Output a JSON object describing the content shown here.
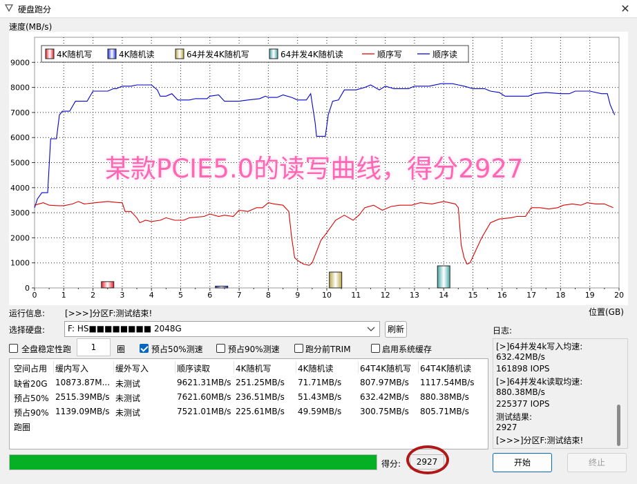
{
  "window": {
    "title": "硬盘跑分",
    "close_glyph": "✕"
  },
  "chart_labels": {
    "y_unit": "速度(MB/s)",
    "x_unit": "位置(GB)"
  },
  "watermark": "某款PCIE5.0的读写曲线，得分2927",
  "chart_data": {
    "type": "line",
    "ylim": [
      0,
      10000
    ],
    "xlim": [
      0,
      20
    ],
    "yticks": [
      0,
      1000,
      2000,
      3000,
      4000,
      5000,
      6000,
      7000,
      8000,
      9000
    ],
    "xticks": [
      0,
      1,
      2,
      3,
      4,
      5,
      6,
      7,
      8,
      9,
      10,
      11,
      12,
      13,
      14,
      15,
      16,
      17,
      18,
      19,
      20
    ],
    "grid": true,
    "legend_placement": "top-left",
    "legend": [
      "4K随机写",
      "4K随机读",
      "64并发4K随机写",
      "64并发4K随机读",
      "顺序写",
      "顺序读"
    ],
    "colors": {
      "seq_write": "#dd0000",
      "seq_read": "#0000cc",
      "bar_4k_write": "#e8202a",
      "bar_4k_read": "#2030e0",
      "bar_64_write": "#b8a848",
      "bar_64_read": "#48a8a8"
    },
    "series": [
      {
        "name": "顺序读",
        "type": "line",
        "color": "#0000cc",
        "points": [
          [
            0,
            3200
          ],
          [
            0.1,
            3550
          ],
          [
            0.25,
            3800
          ],
          [
            0.45,
            3800
          ],
          [
            0.55,
            5950
          ],
          [
            0.75,
            5950
          ],
          [
            0.85,
            6900
          ],
          [
            0.95,
            7050
          ],
          [
            1.2,
            7050
          ],
          [
            1.4,
            7450
          ],
          [
            1.8,
            7450
          ],
          [
            2.0,
            7850
          ],
          [
            2.5,
            7850
          ],
          [
            2.7,
            7950
          ],
          [
            2.8,
            7950
          ],
          [
            3.0,
            8050
          ],
          [
            3.3,
            8050
          ],
          [
            3.5,
            8100
          ],
          [
            4.0,
            8100
          ],
          [
            4.2,
            7900
          ],
          [
            4.3,
            7650
          ],
          [
            4.5,
            7650
          ],
          [
            4.7,
            7750
          ],
          [
            4.9,
            7500
          ],
          [
            5.3,
            7500
          ],
          [
            5.5,
            7550
          ],
          [
            5.9,
            7550
          ],
          [
            6.0,
            7650
          ],
          [
            6.3,
            7700
          ],
          [
            6.5,
            7450
          ],
          [
            7.0,
            7450
          ],
          [
            7.3,
            7500
          ],
          [
            7.7,
            7550
          ],
          [
            7.9,
            7650
          ],
          [
            8.0,
            7600
          ],
          [
            8.3,
            7600
          ],
          [
            8.5,
            7700
          ],
          [
            8.8,
            7600
          ],
          [
            9.0,
            7500
          ],
          [
            9.3,
            7500
          ],
          [
            9.45,
            7750
          ],
          [
            9.6,
            6600
          ],
          [
            9.65,
            6050
          ],
          [
            9.95,
            6050
          ],
          [
            10.05,
            6900
          ],
          [
            10.2,
            7450
          ],
          [
            10.4,
            7500
          ],
          [
            10.6,
            7900
          ],
          [
            11.0,
            7900
          ],
          [
            11.3,
            8000
          ],
          [
            11.5,
            8100
          ],
          [
            11.8,
            7900
          ],
          [
            12.0,
            8050
          ],
          [
            12.3,
            7950
          ],
          [
            12.8,
            7950
          ],
          [
            13.0,
            8050
          ],
          [
            13.5,
            8050
          ],
          [
            13.9,
            8150
          ],
          [
            14.3,
            8150
          ],
          [
            14.5,
            8100
          ],
          [
            14.7,
            8050
          ],
          [
            15.0,
            7950
          ],
          [
            15.4,
            7950
          ],
          [
            15.6,
            7850
          ],
          [
            15.9,
            7800
          ],
          [
            16.1,
            7650
          ],
          [
            16.9,
            7650
          ],
          [
            17.1,
            7750
          ],
          [
            17.5,
            7800
          ],
          [
            18.0,
            7750
          ],
          [
            18.3,
            7750
          ],
          [
            18.5,
            7850
          ],
          [
            19.0,
            7850
          ],
          [
            19.2,
            7800
          ],
          [
            19.4,
            7750
          ],
          [
            19.6,
            7750
          ],
          [
            19.7,
            7300
          ],
          [
            19.85,
            6900
          ]
        ]
      },
      {
        "name": "顺序写",
        "type": "line",
        "color": "#dd0000",
        "points": [
          [
            0,
            3300
          ],
          [
            0.3,
            3400
          ],
          [
            0.5,
            3300
          ],
          [
            0.8,
            3280
          ],
          [
            1.0,
            3280
          ],
          [
            1.3,
            3350
          ],
          [
            1.5,
            3450
          ],
          [
            1.7,
            3350
          ],
          [
            2.1,
            3400
          ],
          [
            2.5,
            3450
          ],
          [
            2.9,
            3400
          ],
          [
            3.0,
            3400
          ],
          [
            3.1,
            3050
          ],
          [
            3.3,
            3050
          ],
          [
            3.5,
            2800
          ],
          [
            3.6,
            2600
          ],
          [
            3.8,
            2700
          ],
          [
            4.0,
            2650
          ],
          [
            4.3,
            2700
          ],
          [
            4.5,
            2800
          ],
          [
            4.8,
            2700
          ],
          [
            5.1,
            2700
          ],
          [
            5.3,
            2800
          ],
          [
            5.8,
            2850
          ],
          [
            6.0,
            2950
          ],
          [
            6.3,
            2850
          ],
          [
            6.5,
            2900
          ],
          [
            6.8,
            2850
          ],
          [
            7.0,
            3100
          ],
          [
            7.3,
            3050
          ],
          [
            7.6,
            3200
          ],
          [
            7.8,
            3200
          ],
          [
            8.0,
            3400
          ],
          [
            8.2,
            3350
          ],
          [
            8.5,
            3300
          ],
          [
            8.7,
            3050
          ],
          [
            8.8,
            2000
          ],
          [
            8.9,
            1200
          ],
          [
            9.0,
            1100
          ],
          [
            9.2,
            950
          ],
          [
            9.4,
            900
          ],
          [
            9.5,
            1000
          ],
          [
            9.7,
            1600
          ],
          [
            9.8,
            1900
          ],
          [
            10.0,
            2200
          ],
          [
            10.3,
            2700
          ],
          [
            10.6,
            2900
          ],
          [
            10.9,
            2700
          ],
          [
            11.1,
            2900
          ],
          [
            11.3,
            3200
          ],
          [
            11.6,
            3300
          ],
          [
            11.9,
            3100
          ],
          [
            12.2,
            3250
          ],
          [
            12.5,
            3300
          ],
          [
            12.9,
            3300
          ],
          [
            13.2,
            3400
          ],
          [
            13.6,
            3350
          ],
          [
            14.0,
            3450
          ],
          [
            14.4,
            3350
          ],
          [
            14.5,
            3200
          ],
          [
            14.6,
            1700
          ],
          [
            14.7,
            1200
          ],
          [
            14.8,
            950
          ],
          [
            14.9,
            1000
          ],
          [
            15.1,
            1500
          ],
          [
            15.3,
            2000
          ],
          [
            15.6,
            2600
          ],
          [
            15.9,
            2750
          ],
          [
            16.3,
            2800
          ],
          [
            16.5,
            2850
          ],
          [
            16.8,
            2850
          ],
          [
            17.0,
            3200
          ],
          [
            17.3,
            3200
          ],
          [
            17.6,
            3150
          ],
          [
            17.9,
            3200
          ],
          [
            18.1,
            3300
          ],
          [
            18.4,
            3350
          ],
          [
            18.7,
            3300
          ],
          [
            18.9,
            3400
          ],
          [
            19.2,
            3350
          ],
          [
            19.5,
            3350
          ],
          [
            19.8,
            3200
          ]
        ]
      },
      {
        "name": "4K随机写",
        "type": "bar",
        "x": 2.5,
        "value": 251.25
      },
      {
        "name": "4K随机读",
        "type": "bar",
        "x": 6.4,
        "value": 71.71
      },
      {
        "name": "64并发4K随机写",
        "type": "bar",
        "x": 10.3,
        "value": 632.42
      },
      {
        "name": "64并发4K随机读",
        "type": "bar",
        "x": 14.0,
        "value": 880.38
      }
    ]
  },
  "controls": {
    "run_info_label": "运行信息:",
    "run_info_value": "[>>>]分区F:测试结束!",
    "disk_label": "选择硬盘:",
    "disk_value": "F: HS■■■■■■■■ 2048G",
    "refresh_label": "刷新",
    "full_disk_label": "全盘稳定性跑",
    "laps_value": "1",
    "laps_unit": "圈",
    "prefill50_label": "预占50%测速",
    "prefill90_label": "预占90%测速",
    "trim_label": "跑分前TRIM",
    "cache_label": "启用系统缓存"
  },
  "table": {
    "headers": [
      "空间占用",
      "缓内写入",
      "缓外写入",
      "顺序读取",
      "4K随机写",
      "4K随机读",
      "64T4K随机写",
      "64T4K随机读"
    ],
    "rows": [
      [
        "缺省20G",
        "10873.87M...",
        "未测试",
        "9621.31MB/s",
        "251.25MB/s",
        "71.71MB/s",
        "807.97MB/s",
        "1117.54MB/s"
      ],
      [
        "预占50%",
        "2515.39MB/s",
        "未测试",
        "7621.60MB/s",
        "236.51MB/s",
        "51.43MB/s",
        "632.42MB/s",
        "880.38MB/s"
      ],
      [
        "预占90%",
        "1139.09MB/s",
        "未测试",
        "7521.01MB/s",
        "225.61MB/s",
        "49.59MB/s",
        "300.75MB/s",
        "805.71MB/s"
      ],
      [
        "跑圈",
        "",
        "",
        "",
        "",
        "",
        "",
        ""
      ]
    ]
  },
  "log": {
    "label": "日志:",
    "lines": [
      "[>]64并发4k写入均速:",
      "632.42MB/s",
      "161898 IOPS",
      "[>]64并发4k读取均速:",
      "880.38MB/s",
      "225377 IOPS",
      "测试结果:",
      "2927",
      "[>>>]分区F:测试结束!"
    ]
  },
  "bottom": {
    "progress_percent": 100,
    "score_label": "得分:",
    "score_value": "2927",
    "start_label": "开始",
    "stop_label": "终止"
  }
}
